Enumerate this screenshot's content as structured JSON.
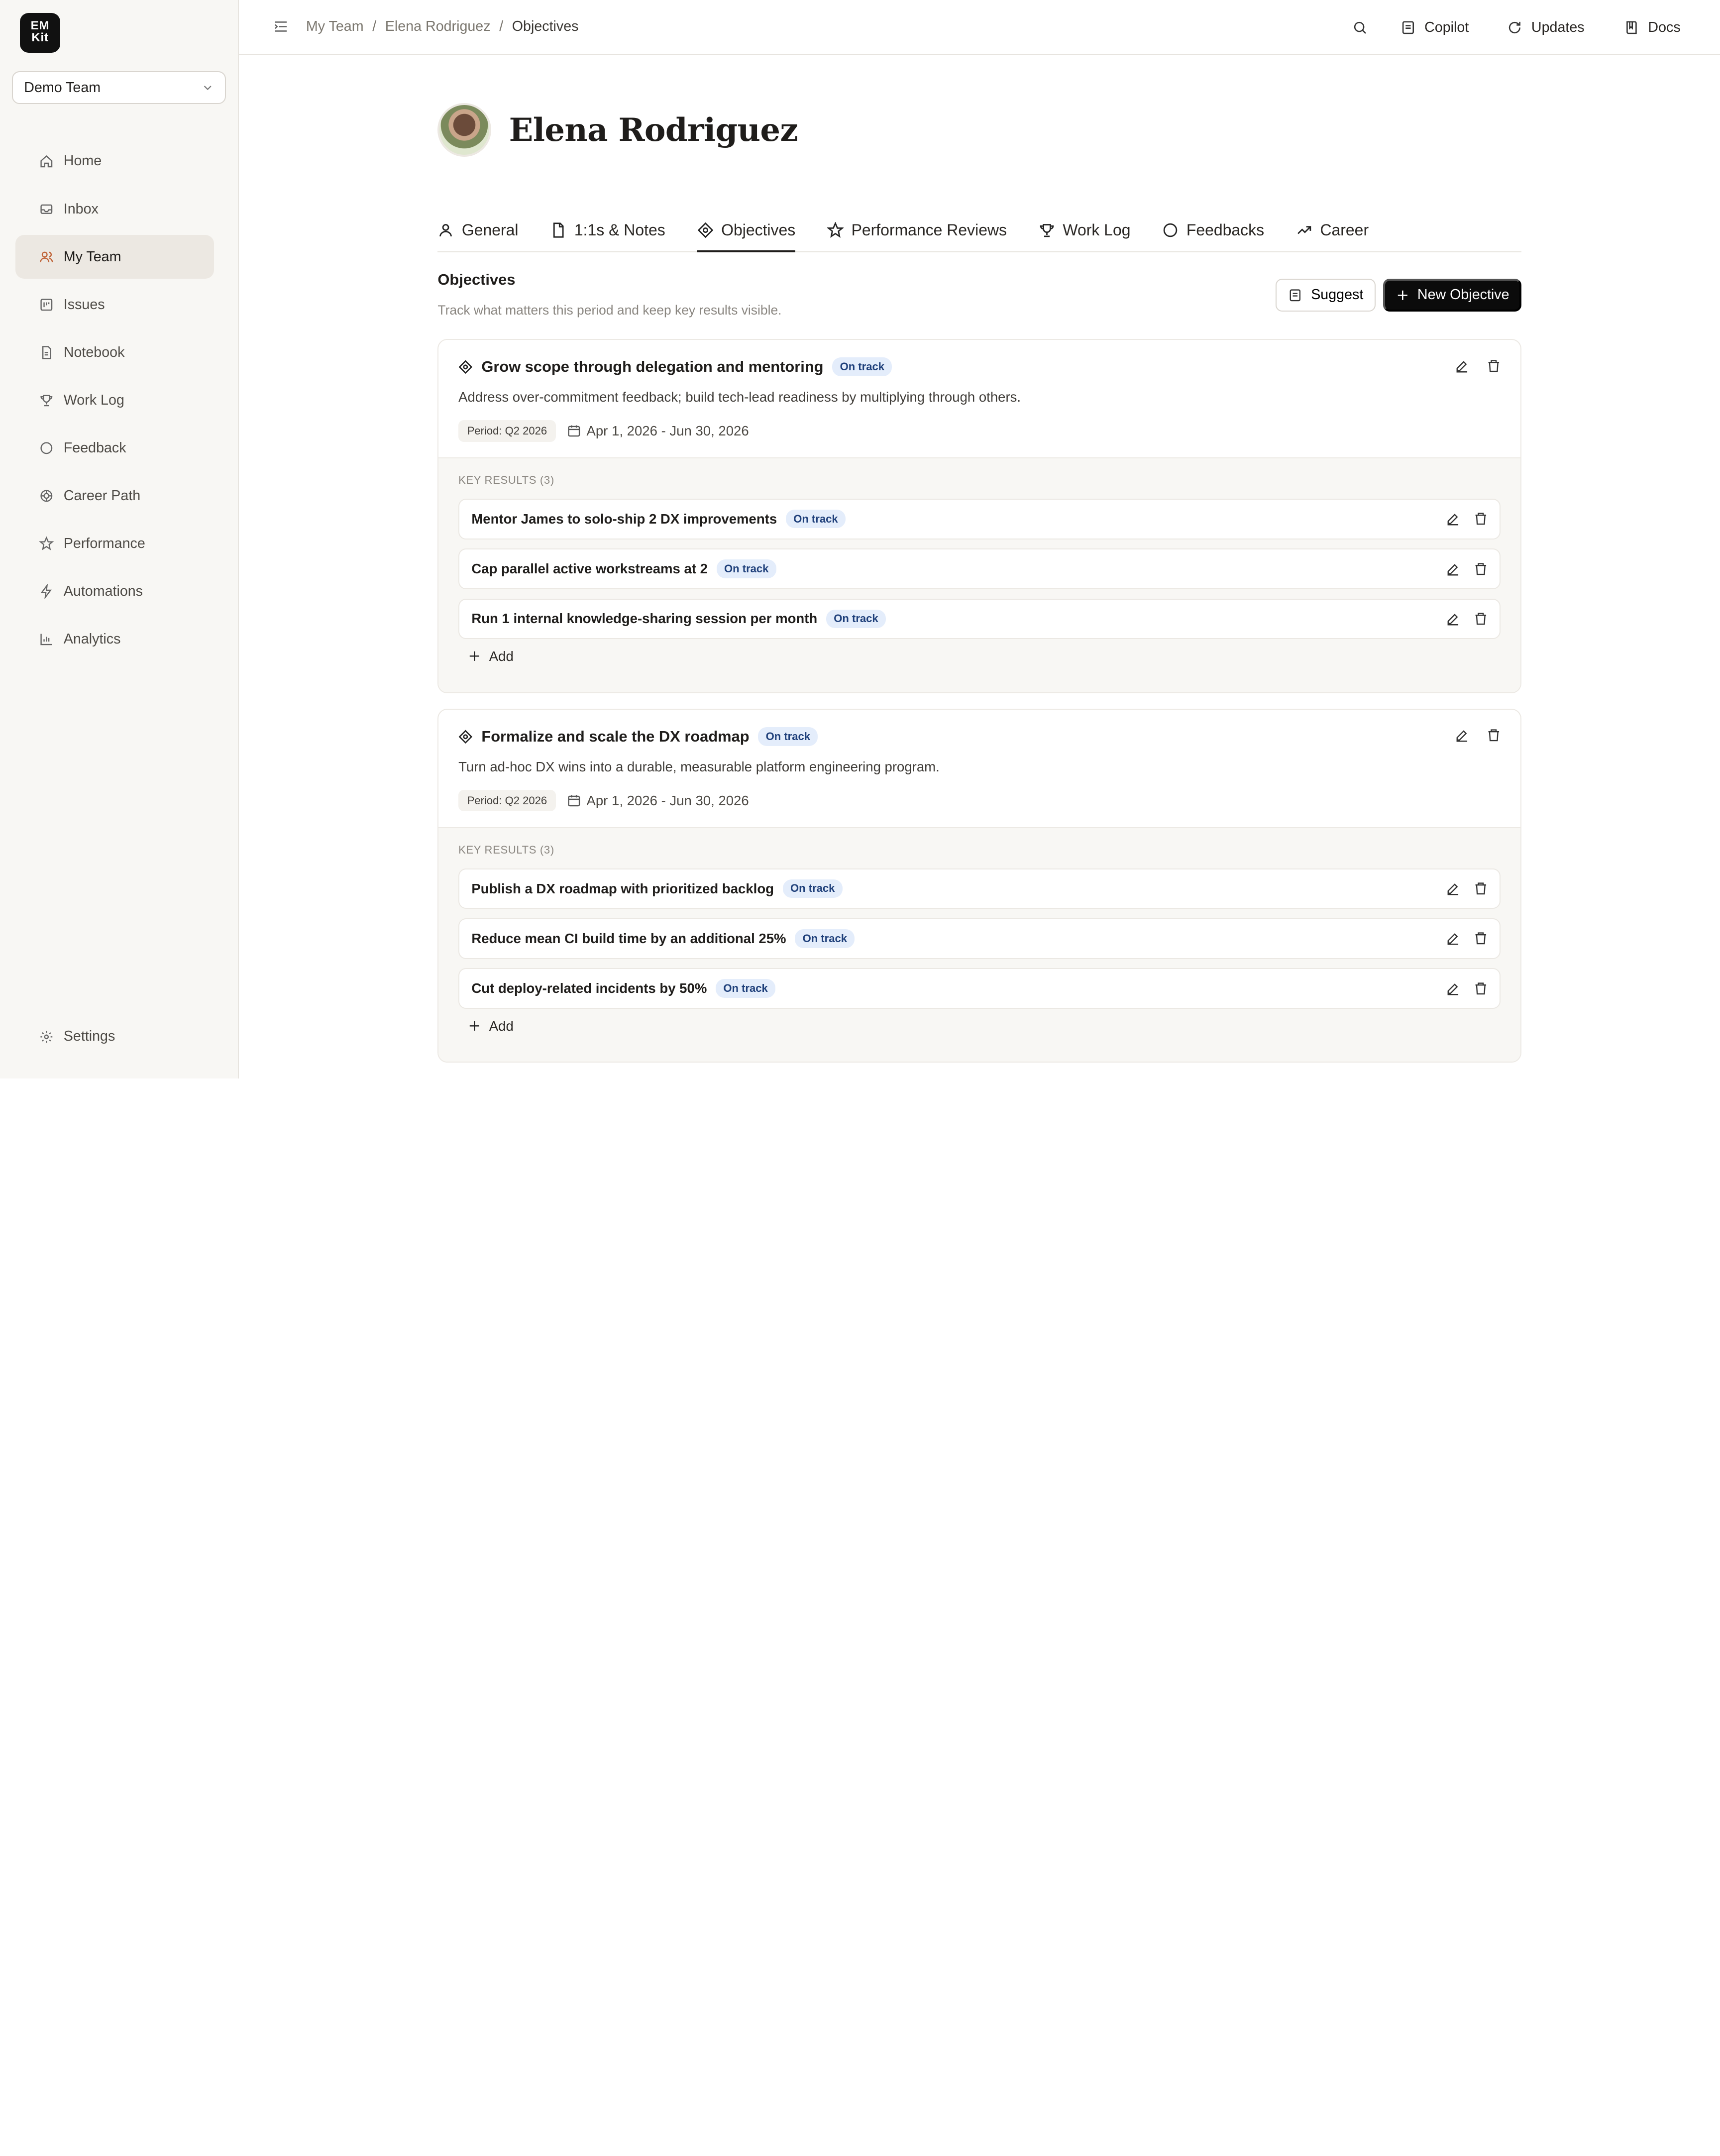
{
  "app": {
    "logo": "EM Kit",
    "team": "Demo Team"
  },
  "sidebar": {
    "items": [
      {
        "label": "Home",
        "icon": "home-icon"
      },
      {
        "label": "Inbox",
        "icon": "inbox-icon"
      },
      {
        "label": "My Team",
        "icon": "users-icon",
        "active": true
      },
      {
        "label": "Issues",
        "icon": "issues-icon"
      },
      {
        "label": "Notebook",
        "icon": "notebook-icon"
      },
      {
        "label": "Work Log",
        "icon": "trophy-icon"
      },
      {
        "label": "Feedback",
        "icon": "chat-icon"
      },
      {
        "label": "Career Path",
        "icon": "career-icon"
      },
      {
        "label": "Performance",
        "icon": "star-icon"
      },
      {
        "label": "Automations",
        "icon": "bolt-icon"
      },
      {
        "label": "Analytics",
        "icon": "chart-icon"
      }
    ],
    "settings": "Settings"
  },
  "topbar": {
    "breadcrumb": [
      "My Team",
      "Elena Rodriguez",
      "Objectives"
    ],
    "actions": {
      "copilot": "Copilot",
      "updates": "Updates",
      "docs": "Docs"
    }
  },
  "person": {
    "name": "Elena Rodriguez"
  },
  "tabs": [
    "General",
    "1:1s & Notes",
    "Objectives",
    "Performance Reviews",
    "Work Log",
    "Feedbacks",
    "Career"
  ],
  "active_tab": "Objectives",
  "section": {
    "title": "Objectives",
    "subtitle": "Track what matters this period and keep key results visible.",
    "suggest": "Suggest",
    "new_objective": "New Objective"
  },
  "objectives": [
    {
      "title": "Grow scope through delegation and mentoring",
      "status": "On track",
      "description": "Address over-commitment feedback; build tech-lead readiness by multiplying through others.",
      "period": "Period: Q2 2026",
      "dates": "Apr 1, 2026 - Jun 30, 2026",
      "kr_label": "KEY RESULTS (3)",
      "key_results": [
        {
          "text": "Mentor James to solo-ship 2 DX improvements",
          "status": "On track"
        },
        {
          "text": "Cap parallel active workstreams at 2",
          "status": "On track"
        },
        {
          "text": "Run 1 internal knowledge-sharing session per month",
          "status": "On track"
        }
      ],
      "add": "Add"
    },
    {
      "title": "Formalize and scale the DX roadmap",
      "status": "On track",
      "description": "Turn ad-hoc DX wins into a durable, measurable platform engineering program.",
      "period": "Period: Q2 2026",
      "dates": "Apr 1, 2026 - Jun 30, 2026",
      "kr_label": "KEY RESULTS (3)",
      "key_results": [
        {
          "text": "Publish a DX roadmap with prioritized backlog",
          "status": "On track"
        },
        {
          "text": "Reduce mean CI build time by an additional 25%",
          "status": "On track"
        },
        {
          "text": "Cut deploy-related incidents by 50%",
          "status": "On track"
        }
      ],
      "add": "Add"
    }
  ]
}
